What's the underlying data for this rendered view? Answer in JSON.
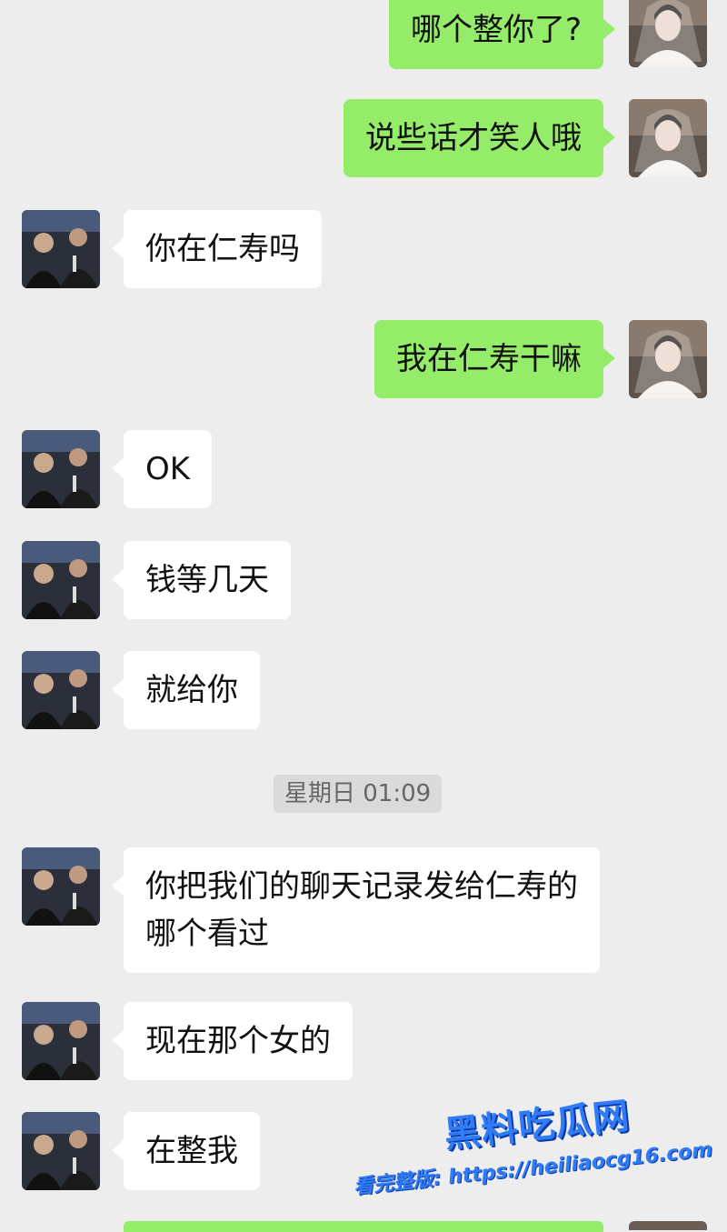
{
  "messages": [
    {
      "side": "out",
      "text": "哪个整你了?"
    },
    {
      "side": "out",
      "text": "说些话才笑人哦"
    },
    {
      "side": "in",
      "text": "你在仁寿吗"
    },
    {
      "side": "out",
      "text": "我在仁寿干嘛"
    },
    {
      "side": "in",
      "text": "OK"
    },
    {
      "side": "in",
      "text": "钱等几天"
    },
    {
      "side": "in",
      "text": "就给你"
    },
    {
      "side": "in",
      "text": "你把我们的聊天记录发给仁寿的哪个看过"
    },
    {
      "side": "in",
      "text": "现在那个女的"
    },
    {
      "side": "in",
      "text": "在整我"
    }
  ],
  "timestamp": "星期日 01:09",
  "watermark": {
    "logo": "黑料吃瓜网",
    "url": "看完整版: https://heiliaocg16.com"
  },
  "colors": {
    "background": "#ededed",
    "outgoing_bubble": "#95ec69",
    "incoming_bubble": "#ffffff",
    "watermark": "#2f7cf6"
  },
  "icons": {
    "incoming_avatar": "group-photo-avatar",
    "outgoing_avatar": "bride-photo-avatar"
  }
}
